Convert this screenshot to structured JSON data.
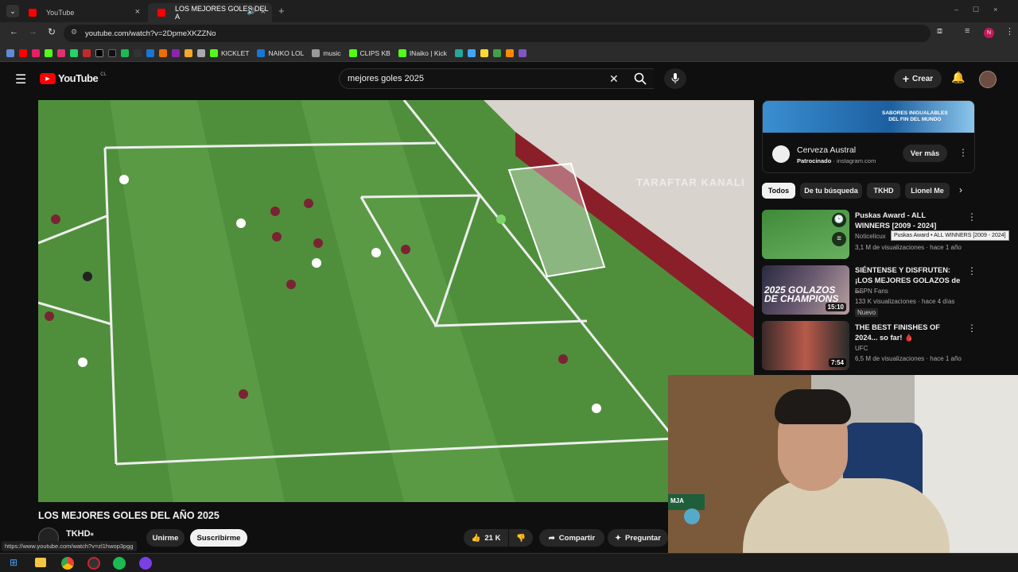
{
  "browser": {
    "tabs": [
      {
        "label": "YouTube"
      },
      {
        "label": "LOS MEJORES GOLES DEL A"
      }
    ],
    "url": "youtube.com/watch?v=2DpmeXKZZNo",
    "bookmarks": [
      "KICKLET",
      "NAIKO LOL",
      "music",
      "CLIPS KB",
      "INaiko | Kick"
    ],
    "status_url": "https://www.youtube.com/watch?v=zl1hwop3pgg"
  },
  "youtube": {
    "logo": "YouTube",
    "logo_region": "CL",
    "search_value": "mejores goles 2025",
    "create_label": "Crear"
  },
  "video": {
    "watermark": "TARAFTAR KANALI",
    "title": "LOS MEJORES GOLES DEL AÑO 2025",
    "channel": "TKHD",
    "join_label": "Unirme",
    "subscribe_label": "Suscribirme",
    "likes": "21 K",
    "share_label": "Compartir",
    "ask_label": "Preguntar"
  },
  "ad": {
    "banner_line1": "SABORES INIGUALABLES",
    "banner_line2": "DEL FIN DEL MUNDO",
    "name": "Cerveza Austral",
    "sponsored": "Patrocinado",
    "source": "instagram.com",
    "cta": "Ver más"
  },
  "chips": [
    "Todos",
    "De tu búsqueda",
    "TKHD",
    "Lionel Me"
  ],
  "recommendations": [
    {
      "title": "Puskas Award - ALL WINNERS [2009 - 2024]",
      "channel": "Noticelicux",
      "meta": "3,1 M de visualizaciones · hace 1 año",
      "duration": ""
    },
    {
      "title": "SIÉNTENSE Y DISFRUTEN: ¡LOS MEJORES GOLAZOS de ...",
      "channel": "ESPN Fans",
      "meta": "133 K visualizaciones · hace 4 días",
      "badge": "Nuevo",
      "duration": "15:10",
      "thumb_text": "2025 GOLAZOS DE CHAMPIONS"
    },
    {
      "title": "THE BEST FINISHES OF 2024... so far! 🩸",
      "channel": "UFC",
      "meta": "6,5 M de visualizaciones · hace 1 año",
      "duration": "7:54"
    }
  ],
  "tooltip": "Puskas Award • ALL WINNERS [2009 - 2024]",
  "colors": {
    "bg": "#0f0f0f",
    "pitch": "#4f8f3c",
    "brand": "#ff0000"
  }
}
